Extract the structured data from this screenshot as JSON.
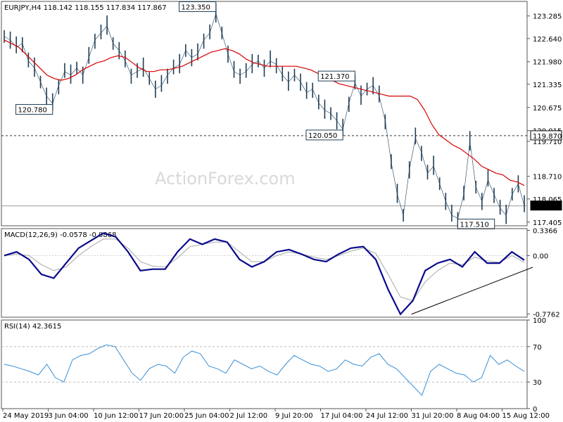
{
  "chart_data": [
    {
      "type": "candlestick",
      "title": "EURJPY,H4  118.142 118.155 117.834 117.867",
      "watermark": "ActionForex.com",
      "ylim": [
        117.3,
        123.7
      ],
      "y_ticks": [
        "123.285",
        "122.640",
        "121.980",
        "121.335",
        "120.675",
        "120.015",
        "119.710",
        "118.710",
        "118.065",
        "117.405"
      ],
      "price_values": [
        122.7,
        122.6,
        122.4,
        122.5,
        122.0,
        121.8,
        121.4,
        121.0,
        120.78,
        121.3,
        121.7,
        121.6,
        121.8,
        121.6,
        122.1,
        122.6,
        122.8,
        123.0,
        122.5,
        122.3,
        122.0,
        121.6,
        121.7,
        121.8,
        121.5,
        121.2,
        121.3,
        121.6,
        121.8,
        121.9,
        122.3,
        122.1,
        122.2,
        122.6,
        122.8,
        123.35,
        122.8,
        122.2,
        121.7,
        121.6,
        121.7,
        121.9,
        122.0,
        121.8,
        122.0,
        121.9,
        121.6,
        121.4,
        121.6,
        121.4,
        121.1,
        121.2,
        120.8,
        120.6,
        120.5,
        120.3,
        120.05,
        120.8,
        121.37,
        121.0,
        121.2,
        121.3,
        121.0,
        120.3,
        119.1,
        118.2,
        117.6,
        118.9,
        119.8,
        119.4,
        118.8,
        119.0,
        118.5,
        118.0,
        117.6,
        117.51,
        118.2,
        119.7,
        118.4,
        118.0,
        118.6,
        118.2,
        117.8,
        117.6,
        118.2,
        118.5,
        117.867
      ],
      "ma_values": [
        122.6,
        122.5,
        122.4,
        122.2,
        122.0,
        121.8,
        121.6,
        121.5,
        121.45,
        121.5,
        121.6,
        121.75,
        121.85,
        121.95,
        122.0,
        122.1,
        122.15,
        122.1,
        121.95,
        121.8,
        121.7,
        121.7,
        121.75,
        121.75,
        121.8,
        121.85,
        121.95,
        122.05,
        122.15,
        122.25,
        122.3,
        122.35,
        122.3,
        122.2,
        122.05,
        121.95,
        121.9,
        121.85,
        121.85,
        121.85,
        121.85,
        121.85,
        121.8,
        121.75,
        121.65,
        121.55,
        121.45,
        121.35,
        121.3,
        121.25,
        121.2,
        121.15,
        121.1,
        121.05,
        121.0,
        121.0,
        121.0,
        121.0,
        120.9,
        120.6,
        120.2,
        119.9,
        119.75,
        119.6,
        119.5,
        119.35,
        119.2,
        119.0,
        118.9,
        118.8,
        118.75,
        118.6,
        118.55,
        118.45
      ],
      "horizontal_levels": [
        {
          "label": "119.870",
          "value": 119.87
        },
        {
          "label": "117.867",
          "value": 117.867
        }
      ],
      "annotations": [
        {
          "label": "123.350",
          "value": 123.35
        },
        {
          "label": "120.780",
          "value": 120.78
        },
        {
          "label": "121.370",
          "value": 121.37
        },
        {
          "label": "120.050",
          "value": 120.05
        },
        {
          "label": "117.510",
          "value": 117.51
        }
      ]
    },
    {
      "type": "line",
      "title": "MACD(12,26,9) -0.0578 -0.0868",
      "ylim": [
        -0.82,
        0.36
      ],
      "y_ticks": [
        "0.3366",
        "0.00",
        "-0.7762"
      ],
      "macd_values": [
        0.0,
        0.05,
        -0.05,
        -0.25,
        -0.3,
        -0.1,
        0.1,
        0.2,
        0.3,
        0.25,
        0.05,
        -0.2,
        -0.18,
        -0.18,
        0.05,
        0.22,
        0.15,
        0.22,
        0.18,
        -0.05,
        -0.15,
        -0.08,
        0.05,
        0.08,
        0.02,
        -0.05,
        -0.08,
        0.02,
        0.1,
        0.12,
        -0.05,
        -0.45,
        -0.78,
        -0.6,
        -0.2,
        -0.1,
        -0.05,
        -0.15,
        0.05,
        -0.1,
        -0.1,
        0.05,
        -0.06
      ],
      "signal_values": [
        0.0,
        0.02,
        0.0,
        -0.12,
        -0.2,
        -0.15,
        0.0,
        0.12,
        0.22,
        0.22,
        0.1,
        -0.08,
        -0.14,
        -0.15,
        -0.03,
        0.12,
        0.15,
        0.18,
        0.18,
        0.05,
        -0.08,
        -0.08,
        0.0,
        0.05,
        0.02,
        -0.02,
        -0.05,
        0.0,
        0.06,
        0.1,
        0.03,
        -0.25,
        -0.55,
        -0.6,
        -0.35,
        -0.2,
        -0.1,
        -0.12,
        -0.02,
        -0.07,
        -0.09,
        0.0,
        -0.09
      ],
      "trendline": [
        {
          "x": 0.78,
          "value": -0.78
        },
        {
          "x": 1.0,
          "value": -0.08
        }
      ]
    },
    {
      "type": "line",
      "title": "RSI(14) 42.3615",
      "ylim": [
        0,
        100
      ],
      "y_ticks": [
        "100",
        "70",
        "30",
        "0"
      ],
      "levels": [
        70,
        30
      ],
      "rsi_values": [
        50,
        48,
        45,
        42,
        38,
        50,
        35,
        30,
        55,
        60,
        62,
        68,
        72,
        70,
        55,
        40,
        32,
        45,
        50,
        48,
        40,
        58,
        65,
        62,
        48,
        45,
        40,
        55,
        50,
        45,
        48,
        42,
        38,
        50,
        60,
        55,
        50,
        48,
        42,
        45,
        55,
        50,
        48,
        58,
        62,
        50,
        45,
        35,
        25,
        15,
        42,
        50,
        45,
        40,
        38,
        30,
        35,
        60,
        50,
        55,
        48,
        42
      ]
    }
  ],
  "x_axis": {
    "labels": [
      "24 May 2019",
      "3 Jun 04:00",
      "10 Jun 12:00",
      "17 Jun 20:00",
      "25 Jun 04:00",
      "2 Jul 12:00",
      "9 Jul 20:00",
      "17 Jul 04:00",
      "24 Jul 12:00",
      "31 Jul 20:00",
      "8 Aug 04:00",
      "15 Aug 12:00"
    ]
  },
  "colors": {
    "price": "#1f3e57",
    "ma": "#d80000",
    "macd": "#0a0a8c",
    "signal": "#a8a8a8",
    "rsi": "#3a8fd6",
    "grid": "#555555"
  }
}
